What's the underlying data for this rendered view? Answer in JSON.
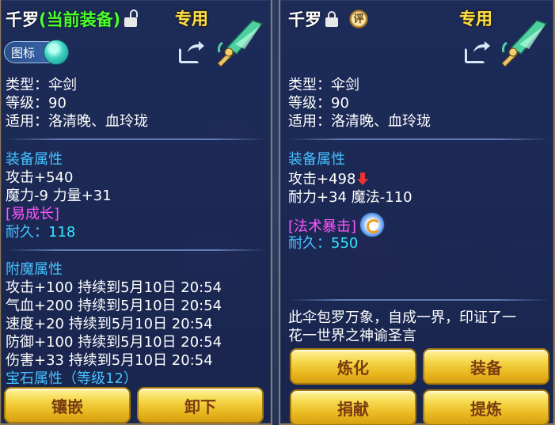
{
  "left": {
    "name": "千罗",
    "status": "(当前装备)",
    "exclusive": "专用",
    "toggle_label": "图标",
    "info": {
      "type": "类型：伞剑",
      "level": "等级：90",
      "suitable": "适用：洛清晚、血玲珑"
    },
    "equip_attr_title": "装备属性",
    "equip_attrs": [
      "攻击+540",
      "魔力-9 力量+31"
    ],
    "growth": "[易成长]",
    "durability_label": "耐久：",
    "durability_value": "118",
    "enchant_title": "附魔属性",
    "enchants": [
      "攻击+100 持续到5月10日 20:54",
      "气血+200 持续到5月10日 20:54",
      "速度+20 持续到5月10日 20:54",
      "防御+100 持续到5月10日 20:54",
      "伤害+33 持续到5月10日 20:54"
    ],
    "gem_attr": "宝石属性（等级12）",
    "buttons": [
      "镶嵌",
      "卸下"
    ]
  },
  "right": {
    "name": "千罗",
    "rating_badge": "评",
    "exclusive": "专用",
    "info": {
      "type": "类型：伞剑",
      "level": "等级：90",
      "suitable": "适用：洛清晚、血玲珑"
    },
    "equip_attr_title": "装备属性",
    "attack": "攻击+498",
    "equip_attr_2": "耐力+34 魔法-110",
    "special": "[法术暴击]",
    "durability_label": "耐久：",
    "durability_value": "550",
    "description_1": "此伞包罗万象，自成一界，印证了一",
    "description_2": "花一世界之神谕圣言",
    "buttons": [
      "炼化",
      "装备",
      "捐献",
      "提炼"
    ]
  },
  "colors": {
    "name_white": "#ffffff",
    "current_green": "#4cff2e",
    "exclusive_gold": "#ffe14a",
    "section_blue": "#46c2ff",
    "special_magenta": "#ff55ff",
    "durability_cyan": "#33e7ff",
    "button_gold": "#f5d74a",
    "button_text": "#7a3c10"
  },
  "icons": [
    "lock-icon",
    "unlock-icon",
    "share-icon",
    "weapon-umbrella-sword-icon",
    "down-arrow-icon",
    "refresh-icon",
    "toggle-knob"
  ]
}
